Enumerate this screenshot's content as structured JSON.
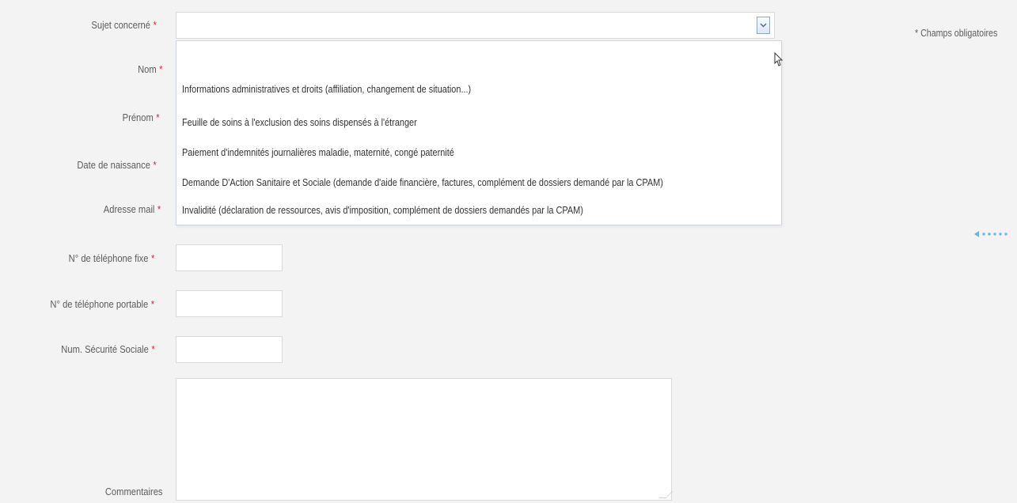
{
  "form": {
    "required_mark": "*",
    "subject": {
      "label": "Sujet concerné",
      "options": [
        "",
        "Informations administratives et droits (affiliation, changement de situation...)",
        "Feuille de soins à l'exclusion des soins dispensés à l'étranger",
        "Paiement d'indemnités journalières maladie, maternité, congé paternité",
        "Demande D'Action Sanitaire et Sociale (demande d'aide financière, factures, complément de dossiers demandé par la CPAM)",
        "Invalidité (déclaration de ressources, avis d'imposition, complément de dossiers demandés par la CPAM)"
      ]
    },
    "labels": {
      "nom": "Nom",
      "prenom": "Prénom",
      "date_naissance": "Date de naissance",
      "adresse_mail": "Adresse mail",
      "tel_fixe": "N° de téléphone fixe",
      "tel_portable": "N° de téléphone portable",
      "num_secu": "Num. Sécurité Sociale",
      "commentaires": "Commentaires"
    },
    "required_note": "* Champs obligatoires"
  },
  "colors": {
    "required": "#d51d3a",
    "arrow_hint": "#67b8e6"
  },
  "icons": {
    "select_arrow": "chevron-down-icon",
    "cursor": "mouse-cursor-icon",
    "hint": "left-arrow-icon"
  }
}
